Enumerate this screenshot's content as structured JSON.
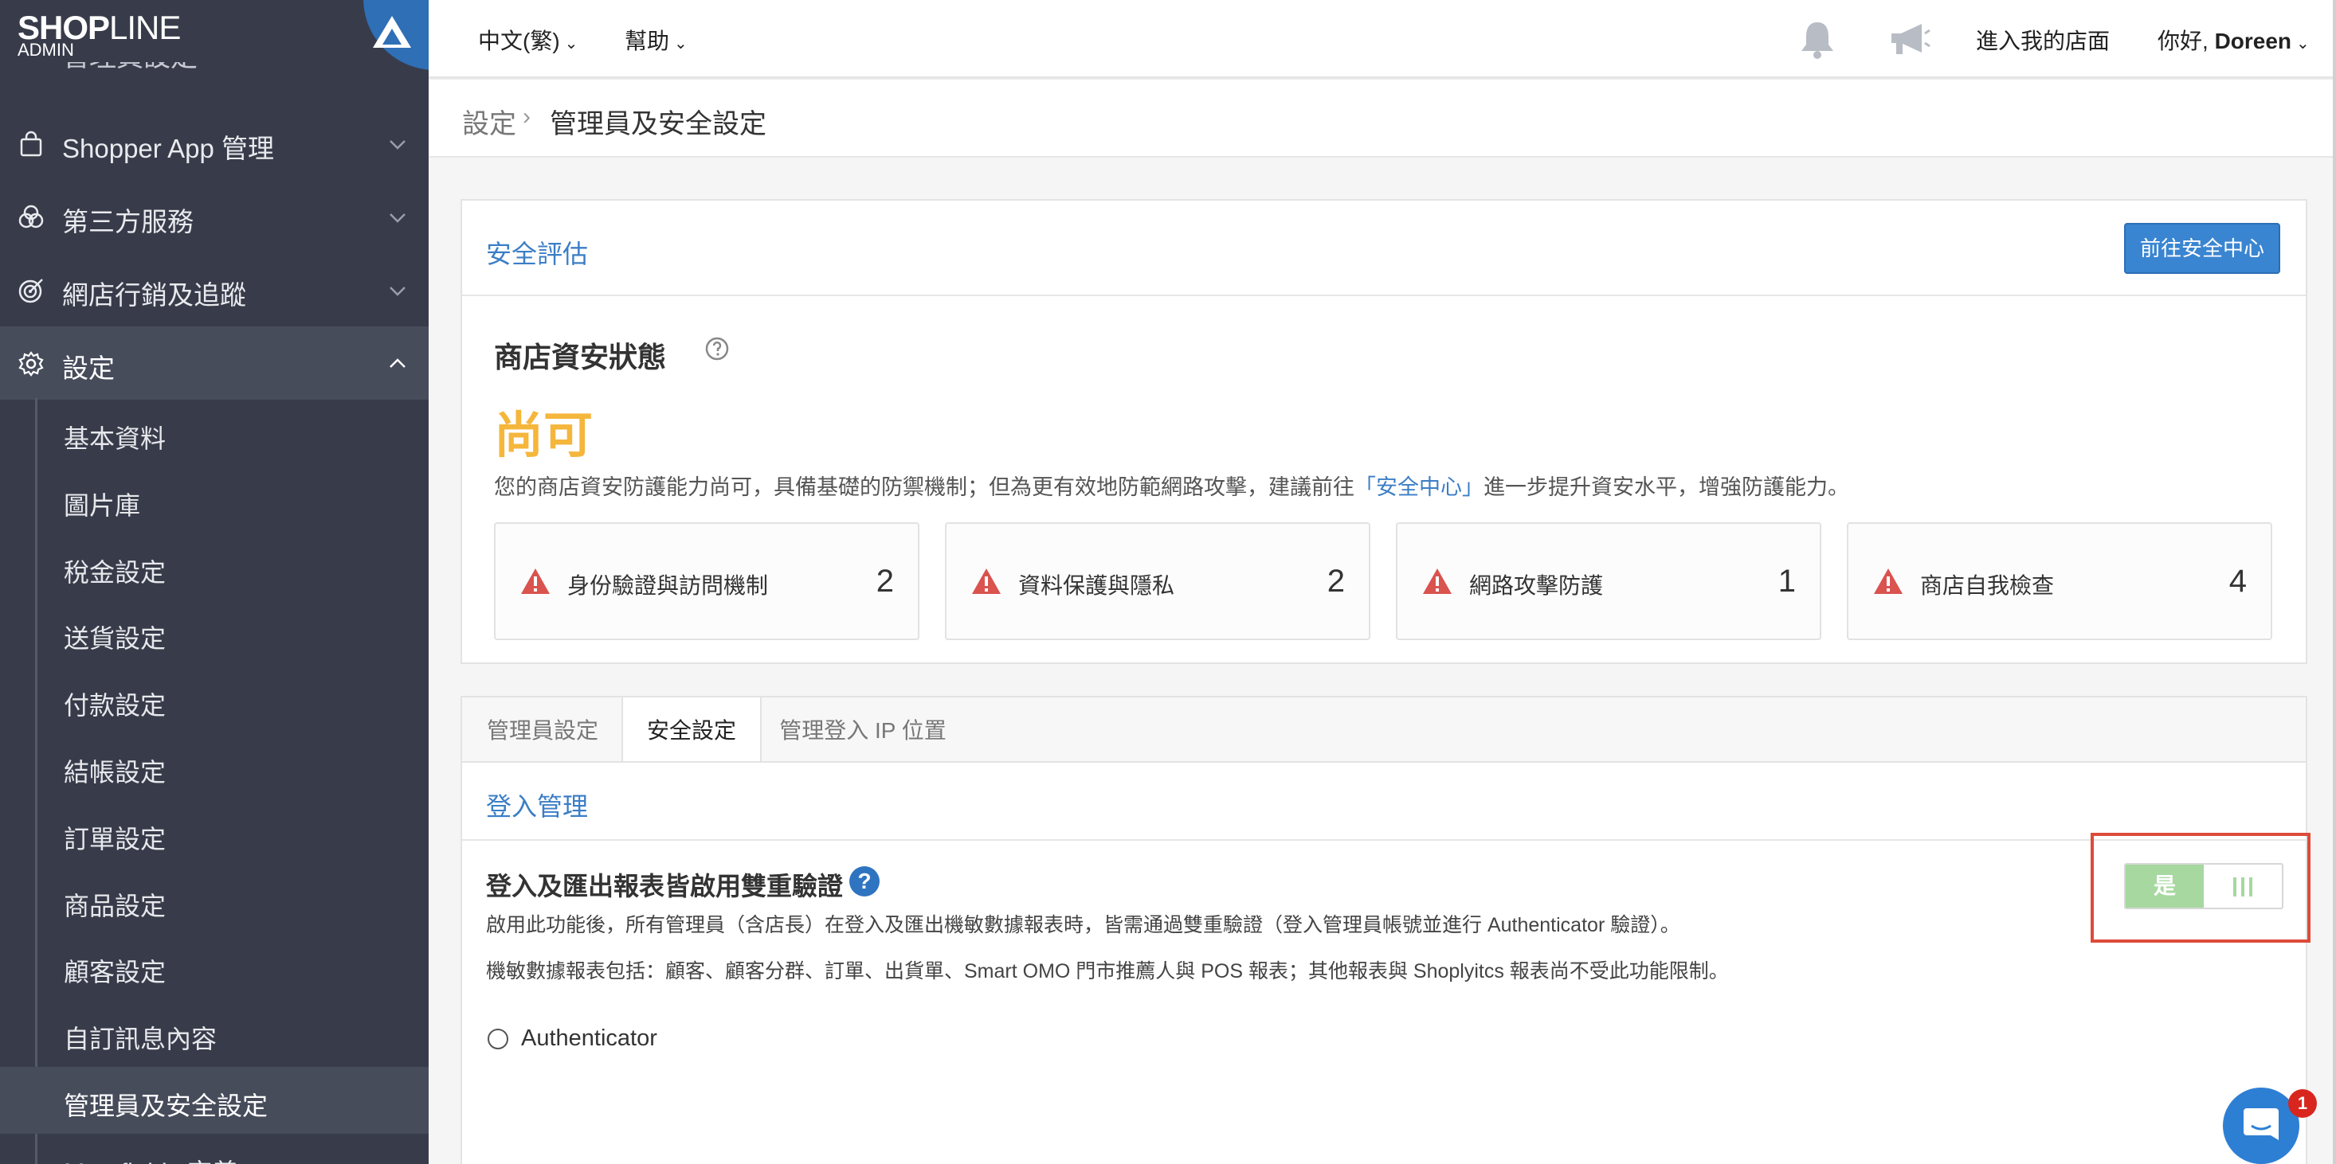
{
  "brand": {
    "logo_main": "SHOP",
    "logo_light": "LINE",
    "sub": "ADMIN"
  },
  "sidebar": {
    "cut_item": "管理員設定",
    "items": [
      {
        "label": "Shopper App 管理",
        "icon": "bag-icon"
      },
      {
        "label": "第三方服務",
        "icon": "circles-icon"
      },
      {
        "label": "網店行銷及追蹤",
        "icon": "target-icon"
      },
      {
        "label": "設定",
        "icon": "gear-icon"
      }
    ],
    "sub_items": [
      "基本資料",
      "圖片庫",
      "稅金設定",
      "送貨設定",
      "付款設定",
      "結帳設定",
      "訂單設定",
      "商品設定",
      "顧客設定",
      "自訂訊息內容",
      "管理員及安全設定",
      "Metafields 定義"
    ]
  },
  "header": {
    "language": "中文(繁)",
    "help": "幫助",
    "enter_store": "進入我的店面",
    "greeting": "你好,",
    "user": "Doreen"
  },
  "breadcrumb": {
    "root": "設定",
    "sep": "›",
    "current": "管理員及安全設定"
  },
  "security": {
    "panel_title": "安全評估",
    "button": "前往安全中心",
    "status_heading": "商店資安狀態",
    "status_level": "尚可",
    "desc_before": "您的商店資安防護能力尚可，具備基礎的防禦機制；但為更有效地防範網路攻擊，建議前往",
    "desc_link": "「安全中心」",
    "desc_after": "進一步提升資安水平，增強防護能力。",
    "cards": [
      {
        "label": "身份驗證與訪問機制",
        "count": "2"
      },
      {
        "label": "資料保護與隱私",
        "count": "2"
      },
      {
        "label": "網路攻擊防護",
        "count": "1"
      },
      {
        "label": "商店自我檢查",
        "count": "4"
      }
    ]
  },
  "tabs": [
    "管理員設定",
    "安全設定",
    "管理登入 IP 位置"
  ],
  "login": {
    "section_title": "登入管理",
    "setting_title": "登入及匯出報表皆啟用雙重驗證",
    "help": "?",
    "desc1": "啟用此功能後，所有管理員（含店長）在登入及匯出機敏數據報表時，皆需通過雙重驗證（登入管理員帳號並進行 Authenticator 驗證）。",
    "desc2": "機敏數據報表包括：顧客、顧客分群、訂單、出貨單、Smart OMO 門市推薦人與 POS 報表；其他報表與 Shoplyitcs 報表尚不受此功能限制。",
    "radio_label": "Authenticator",
    "toggle_label": "是"
  },
  "chat": {
    "badge": "1"
  },
  "colors": {
    "sidebar_bg": "#383c4a",
    "accent_blue": "#3b7ec6",
    "status_yellow": "#f5b63c",
    "warn_red": "#d9534f",
    "toggle_green": "#a6d8a0",
    "highlight_red": "#dd4b39"
  }
}
